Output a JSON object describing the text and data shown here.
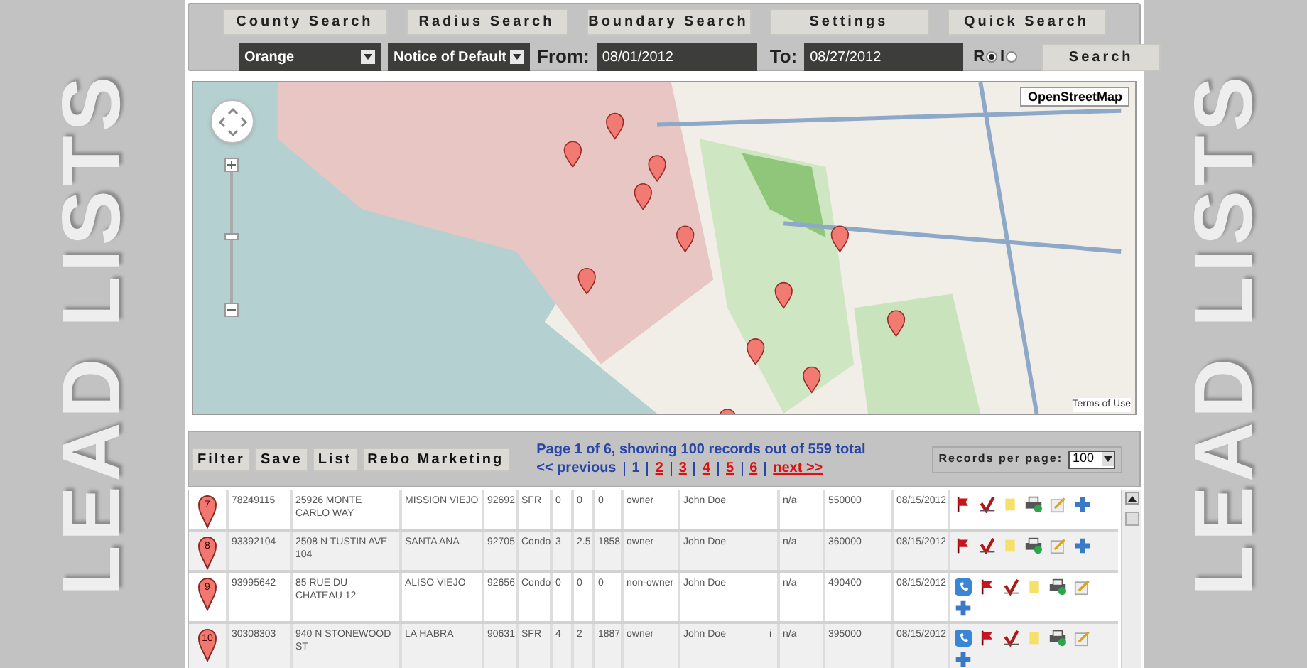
{
  "side_banners": [
    "LEAD LISTS",
    "LEAD LISTS"
  ],
  "nav_buttons": [
    "County Search",
    "Radius Search",
    "Boundary Search",
    "Settings",
    "Quick Search"
  ],
  "search_bar": {
    "county": "Orange",
    "notice_type": "Notice of Default",
    "from_label": "From:",
    "from_value": "08/01/2012",
    "to_label": "To:",
    "to_value": "08/27/2012",
    "radios": [
      {
        "label": "R",
        "selected": true
      },
      {
        "label": "I",
        "selected": false
      }
    ],
    "search_button": "Search"
  },
  "map": {
    "zoom": {
      "level": 0.5
    },
    "layer_button": "OpenStreetMap",
    "terms": "Terms of Use"
  },
  "toolbar": {
    "buttons": [
      "Filter",
      "Save",
      "List",
      "Rebo Marketing"
    ],
    "summary": "Page 1 of 6, showing 100 records out of 559 total",
    "previous": "<< previous",
    "next": "next >>",
    "pages": [
      {
        "label": "1",
        "selected": true
      },
      {
        "label": "2",
        "selected": false
      },
      {
        "label": "3",
        "selected": false
      },
      {
        "label": "4",
        "selected": false
      },
      {
        "label": "5",
        "selected": false
      },
      {
        "label": "6",
        "selected": false
      }
    ],
    "per_page_label": "Records per page:",
    "per_page_value": "100"
  },
  "table": {
    "rows": [
      {
        "pin": "7",
        "id": "78249115",
        "address": "25926 MONTE CARLO WAY",
        "city": "MISSION VIEJO",
        "zip": "92692",
        "type": "SFR",
        "beds": "0",
        "baths": "0",
        "sqft": "0",
        "occupancy": "owner",
        "name": "John Doe",
        "status": "n/a",
        "amount": "550000",
        "date": "08/15/2012",
        "actions": [
          {
            "kind": "flag"
          },
          {
            "kind": "check"
          },
          {
            "kind": "note"
          },
          {
            "kind": "printer"
          },
          {
            "kind": "edit"
          },
          {
            "kind": "plus"
          }
        ]
      },
      {
        "pin": "8",
        "id": "93392104",
        "address": "2508 N TUSTIN AVE 104",
        "city": "SANTA ANA",
        "zip": "92705",
        "type": "Condo",
        "beds": "3",
        "baths": "2.5",
        "sqft": "1858",
        "occupancy": "owner",
        "name": "John Doe",
        "status": "n/a",
        "amount": "360000",
        "date": "08/15/2012",
        "actions": [
          {
            "kind": "flag"
          },
          {
            "kind": "check"
          },
          {
            "kind": "note"
          },
          {
            "kind": "printer"
          },
          {
            "kind": "edit"
          },
          {
            "kind": "plus"
          }
        ]
      },
      {
        "pin": "9",
        "id": "93995642",
        "address": "85 RUE DU CHATEAU 12",
        "city": "ALISO VIEJO",
        "zip": "92656",
        "type": "Condo",
        "beds": "0",
        "baths": "0",
        "sqft": "0",
        "occupancy": "non-owner",
        "name": "John Doe",
        "status": "n/a",
        "amount": "490400",
        "date": "08/15/2012",
        "actions": [
          {
            "kind": "phone"
          },
          {
            "kind": "flag"
          },
          {
            "kind": "check"
          },
          {
            "kind": "note"
          },
          {
            "kind": "printer"
          },
          {
            "kind": "edit"
          },
          {
            "kind": "plus"
          }
        ]
      },
      {
        "pin": "10",
        "id": "30308303",
        "address": "940 N STONEWOOD ST",
        "city": "LA HABRA",
        "zip": "90631",
        "type": "SFR",
        "beds": "4",
        "baths": "2",
        "sqft": "1887",
        "occupancy": "owner",
        "name": "John Doe",
        "note": "i",
        "status": "n/a",
        "amount": "395000",
        "date": "08/15/2012",
        "actions": [
          {
            "kind": "phone"
          },
          {
            "kind": "flag"
          },
          {
            "kind": "check"
          },
          {
            "kind": "note"
          },
          {
            "kind": "printer"
          },
          {
            "kind": "edit"
          },
          {
            "kind": "plus"
          }
        ]
      }
    ]
  }
}
